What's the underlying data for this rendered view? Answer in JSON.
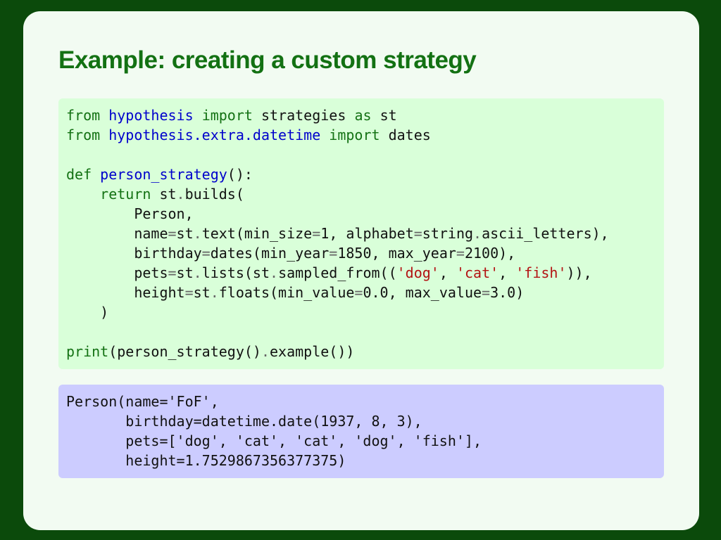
{
  "slide": {
    "title": "Example: creating a custom strategy"
  },
  "code": {
    "language": "python",
    "lines": [
      [
        [
          "kw",
          "from"
        ],
        [
          "plain",
          " "
        ],
        [
          "ns",
          "hypothesis"
        ],
        [
          "plain",
          " "
        ],
        [
          "kw",
          "import"
        ],
        [
          "plain",
          " strategies "
        ],
        [
          "kw",
          "as"
        ],
        [
          "plain",
          " st"
        ]
      ],
      [
        [
          "kw",
          "from"
        ],
        [
          "plain",
          " "
        ],
        [
          "ns",
          "hypothesis.extra.datetime"
        ],
        [
          "plain",
          " "
        ],
        [
          "kw",
          "import"
        ],
        [
          "plain",
          " dates"
        ]
      ],
      [],
      [
        [
          "kw",
          "def"
        ],
        [
          "plain",
          " "
        ],
        [
          "fn",
          "person_strategy"
        ],
        [
          "plain",
          "():"
        ]
      ],
      [
        [
          "plain",
          "    "
        ],
        [
          "kw",
          "return"
        ],
        [
          "plain",
          " st"
        ],
        [
          "op",
          "."
        ],
        [
          "plain",
          "builds("
        ]
      ],
      [
        [
          "plain",
          "        Person,"
        ]
      ],
      [
        [
          "plain",
          "        name"
        ],
        [
          "op",
          "="
        ],
        [
          "plain",
          "st"
        ],
        [
          "op",
          "."
        ],
        [
          "plain",
          "text(min_size"
        ],
        [
          "op",
          "="
        ],
        [
          "plain",
          "1, alphabet"
        ],
        [
          "op",
          "="
        ],
        [
          "plain",
          "string"
        ],
        [
          "op",
          "."
        ],
        [
          "plain",
          "ascii_letters),"
        ]
      ],
      [
        [
          "plain",
          "        birthday"
        ],
        [
          "op",
          "="
        ],
        [
          "plain",
          "dates(min_year"
        ],
        [
          "op",
          "="
        ],
        [
          "plain",
          "1850, max_year"
        ],
        [
          "op",
          "="
        ],
        [
          "plain",
          "2100),"
        ]
      ],
      [
        [
          "plain",
          "        pets"
        ],
        [
          "op",
          "="
        ],
        [
          "plain",
          "st"
        ],
        [
          "op",
          "."
        ],
        [
          "plain",
          "lists(st"
        ],
        [
          "op",
          "."
        ],
        [
          "plain",
          "sampled_from(("
        ],
        [
          "str",
          "'dog'"
        ],
        [
          "plain",
          ", "
        ],
        [
          "str",
          "'cat'"
        ],
        [
          "plain",
          ", "
        ],
        [
          "str",
          "'fish'"
        ],
        [
          "plain",
          ")),"
        ]
      ],
      [
        [
          "plain",
          "        height"
        ],
        [
          "op",
          "="
        ],
        [
          "plain",
          "st"
        ],
        [
          "op",
          "."
        ],
        [
          "plain",
          "floats(min_value"
        ],
        [
          "op",
          "="
        ],
        [
          "plain",
          "0.0, max_value"
        ],
        [
          "op",
          "="
        ],
        [
          "plain",
          "3.0)"
        ]
      ],
      [
        [
          "plain",
          "    )"
        ]
      ],
      [],
      [
        [
          "kw",
          "print"
        ],
        [
          "plain",
          "(person_strategy()"
        ],
        [
          "op",
          "."
        ],
        [
          "plain",
          "example())"
        ]
      ]
    ]
  },
  "output": {
    "lines": [
      "Person(name='FoF',",
      "       birthday=datetime.date(1937, 8, 3),",
      "       pets=['dog', 'cat', 'cat', 'dog', 'fish'],",
      "       height=1.7529867356377375)"
    ]
  },
  "colors": {
    "page_background": "#0b4a0b",
    "slide_background": "#f2fbf2",
    "title": "#137113",
    "code_background": "#d9ffd9",
    "output_background": "#ccccff",
    "keyword": "#137113",
    "name": "#0000cc",
    "string": "#b31212"
  }
}
